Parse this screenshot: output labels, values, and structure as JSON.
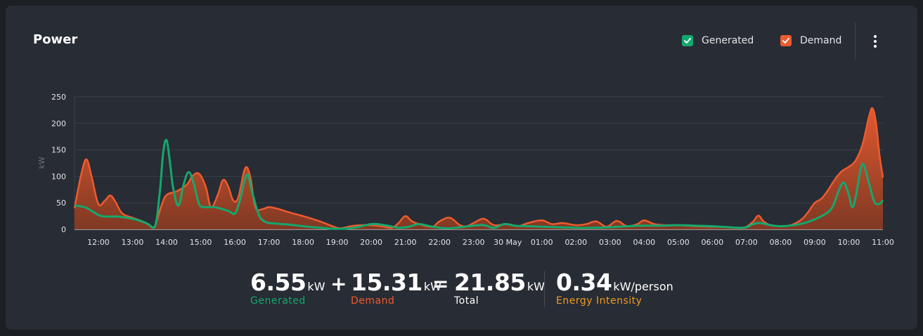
{
  "card": {
    "title": "Power"
  },
  "legend": {
    "generated": {
      "label": "Generated",
      "color": "#13a86d"
    },
    "demand": {
      "label": "Demand",
      "color": "#ec5b2f"
    }
  },
  "menu": {
    "icon": "more-vertical-icon"
  },
  "summary": {
    "generated": {
      "value": "6.55",
      "unit": "kW",
      "label": "Generated"
    },
    "plus": "+",
    "demand": {
      "value": "15.31",
      "unit": "kW",
      "label": "Demand"
    },
    "equals": "=",
    "total": {
      "value": "21.85",
      "unit": "kW",
      "label": "Total"
    },
    "intensity": {
      "value": "0.34",
      "unit": "kW/person",
      "label": "Energy Intensity",
      "color": "#f29b1f"
    }
  },
  "chart_data": {
    "type": "area",
    "ylabel": "kW",
    "ylim": [
      0,
      250
    ],
    "yticks": [
      0,
      50,
      100,
      150,
      200,
      250
    ],
    "grid": true,
    "x_tick_labels": [
      "12:00",
      "13:00",
      "14:00",
      "15:00",
      "16:00",
      "17:00",
      "18:00",
      "19:00",
      "20:00",
      "21:00",
      "22:00",
      "23:00",
      "30 May",
      "01:00",
      "02:00",
      "03:00",
      "04:00",
      "05:00",
      "06:00",
      "07:00",
      "08:00",
      "09:00",
      "10:00",
      "11:00"
    ],
    "x_hours_range": [
      11.3,
      35
    ],
    "series": [
      {
        "name": "Demand",
        "color": "#ec5b2f",
        "points": [
          [
            11.3,
            40
          ],
          [
            11.5,
            105
          ],
          [
            11.65,
            132
          ],
          [
            11.8,
            100
          ],
          [
            12.0,
            48
          ],
          [
            12.2,
            55
          ],
          [
            12.35,
            64
          ],
          [
            12.5,
            52
          ],
          [
            12.7,
            30
          ],
          [
            13.0,
            22
          ],
          [
            13.3,
            15
          ],
          [
            13.5,
            8
          ],
          [
            13.65,
            6
          ],
          [
            13.85,
            45
          ],
          [
            14.0,
            65
          ],
          [
            14.3,
            72
          ],
          [
            14.6,
            85
          ],
          [
            14.75,
            100
          ],
          [
            14.95,
            105
          ],
          [
            15.15,
            80
          ],
          [
            15.3,
            42
          ],
          [
            15.5,
            65
          ],
          [
            15.65,
            93
          ],
          [
            15.8,
            82
          ],
          [
            15.95,
            55
          ],
          [
            16.1,
            60
          ],
          [
            16.3,
            115
          ],
          [
            16.45,
            100
          ],
          [
            16.6,
            42
          ],
          [
            16.8,
            38
          ],
          [
            17.0,
            42
          ],
          [
            17.3,
            38
          ],
          [
            17.6,
            32
          ],
          [
            18.0,
            25
          ],
          [
            18.5,
            15
          ],
          [
            18.9,
            5
          ],
          [
            19.1,
            2
          ],
          [
            19.4,
            6
          ],
          [
            19.7,
            8
          ],
          [
            20.0,
            8
          ],
          [
            20.3,
            6
          ],
          [
            20.6,
            3
          ],
          [
            20.8,
            12
          ],
          [
            21.0,
            25
          ],
          [
            21.2,
            15
          ],
          [
            21.5,
            8
          ],
          [
            21.8,
            5
          ],
          [
            22.0,
            15
          ],
          [
            22.3,
            22
          ],
          [
            22.6,
            8
          ],
          [
            22.8,
            6
          ],
          [
            23.0,
            12
          ],
          [
            23.3,
            20
          ],
          [
            23.6,
            8
          ],
          [
            24.0,
            10
          ],
          [
            24.3,
            6
          ],
          [
            24.6,
            12
          ],
          [
            25.0,
            17
          ],
          [
            25.3,
            10
          ],
          [
            25.6,
            12
          ],
          [
            26.0,
            8
          ],
          [
            26.3,
            10
          ],
          [
            26.6,
            15
          ],
          [
            26.9,
            5
          ],
          [
            27.2,
            16
          ],
          [
            27.5,
            6
          ],
          [
            27.8,
            10
          ],
          [
            28.0,
            17
          ],
          [
            28.3,
            10
          ],
          [
            28.6,
            8
          ],
          [
            29.0,
            8
          ],
          [
            29.5,
            6
          ],
          [
            30.0,
            5
          ],
          [
            30.5,
            4
          ],
          [
            30.8,
            3
          ],
          [
            31.0,
            5
          ],
          [
            31.2,
            15
          ],
          [
            31.35,
            26
          ],
          [
            31.5,
            15
          ],
          [
            31.7,
            8
          ],
          [
            32.0,
            6
          ],
          [
            32.3,
            8
          ],
          [
            32.6,
            18
          ],
          [
            32.8,
            32
          ],
          [
            33.0,
            50
          ],
          [
            33.2,
            58
          ],
          [
            33.4,
            75
          ],
          [
            33.6,
            95
          ],
          [
            33.8,
            110
          ],
          [
            34.0,
            118
          ],
          [
            34.2,
            130
          ],
          [
            34.4,
            160
          ],
          [
            34.6,
            215
          ],
          [
            34.7,
            228
          ],
          [
            34.8,
            200
          ],
          [
            34.9,
            140
          ],
          [
            35.0,
            98
          ]
        ]
      },
      {
        "name": "Generated",
        "color": "#13a86d",
        "points": [
          [
            11.3,
            45
          ],
          [
            11.6,
            42
          ],
          [
            11.8,
            35
          ],
          [
            12.1,
            25
          ],
          [
            12.6,
            24
          ],
          [
            13.0,
            20
          ],
          [
            13.4,
            12
          ],
          [
            13.65,
            4
          ],
          [
            13.8,
            70
          ],
          [
            13.9,
            145
          ],
          [
            14.0,
            168
          ],
          [
            14.1,
            125
          ],
          [
            14.2,
            75
          ],
          [
            14.35,
            45
          ],
          [
            14.5,
            85
          ],
          [
            14.65,
            108
          ],
          [
            14.8,
            85
          ],
          [
            14.95,
            48
          ],
          [
            15.1,
            42
          ],
          [
            15.4,
            42
          ],
          [
            15.8,
            35
          ],
          [
            16.0,
            30
          ],
          [
            16.15,
            55
          ],
          [
            16.35,
            103
          ],
          [
            16.5,
            72
          ],
          [
            16.7,
            28
          ],
          [
            16.9,
            14
          ],
          [
            17.2,
            11
          ],
          [
            17.6,
            9
          ],
          [
            18.0,
            6
          ],
          [
            18.5,
            3
          ],
          [
            19.0,
            1
          ],
          [
            19.5,
            3
          ],
          [
            20.0,
            10
          ],
          [
            20.4,
            8
          ],
          [
            20.8,
            3
          ],
          [
            21.1,
            5
          ],
          [
            21.4,
            10
          ],
          [
            21.8,
            5
          ],
          [
            22.2,
            2
          ],
          [
            22.6,
            4
          ],
          [
            23.0,
            7
          ],
          [
            23.3,
            8
          ],
          [
            23.6,
            3
          ],
          [
            23.9,
            10
          ],
          [
            24.2,
            7
          ],
          [
            24.6,
            6
          ],
          [
            25.0,
            5
          ],
          [
            25.5,
            4
          ],
          [
            26.0,
            3
          ],
          [
            26.5,
            3
          ],
          [
            27.0,
            4
          ],
          [
            27.5,
            6
          ],
          [
            28.0,
            7
          ],
          [
            28.5,
            7
          ],
          [
            29.0,
            8
          ],
          [
            29.5,
            7
          ],
          [
            30.0,
            6
          ],
          [
            30.5,
            4
          ],
          [
            30.8,
            3
          ],
          [
            31.0,
            4
          ],
          [
            31.2,
            10
          ],
          [
            31.4,
            12
          ],
          [
            31.7,
            8
          ],
          [
            32.0,
            6
          ],
          [
            32.4,
            8
          ],
          [
            32.8,
            14
          ],
          [
            33.2,
            25
          ],
          [
            33.5,
            40
          ],
          [
            33.7,
            72
          ],
          [
            33.85,
            88
          ],
          [
            34.0,
            65
          ],
          [
            34.1,
            42
          ],
          [
            34.2,
            60
          ],
          [
            34.35,
            115
          ],
          [
            34.45,
            120
          ],
          [
            34.6,
            85
          ],
          [
            34.75,
            52
          ],
          [
            34.9,
            48
          ],
          [
            35.0,
            55
          ]
        ]
      }
    ]
  }
}
